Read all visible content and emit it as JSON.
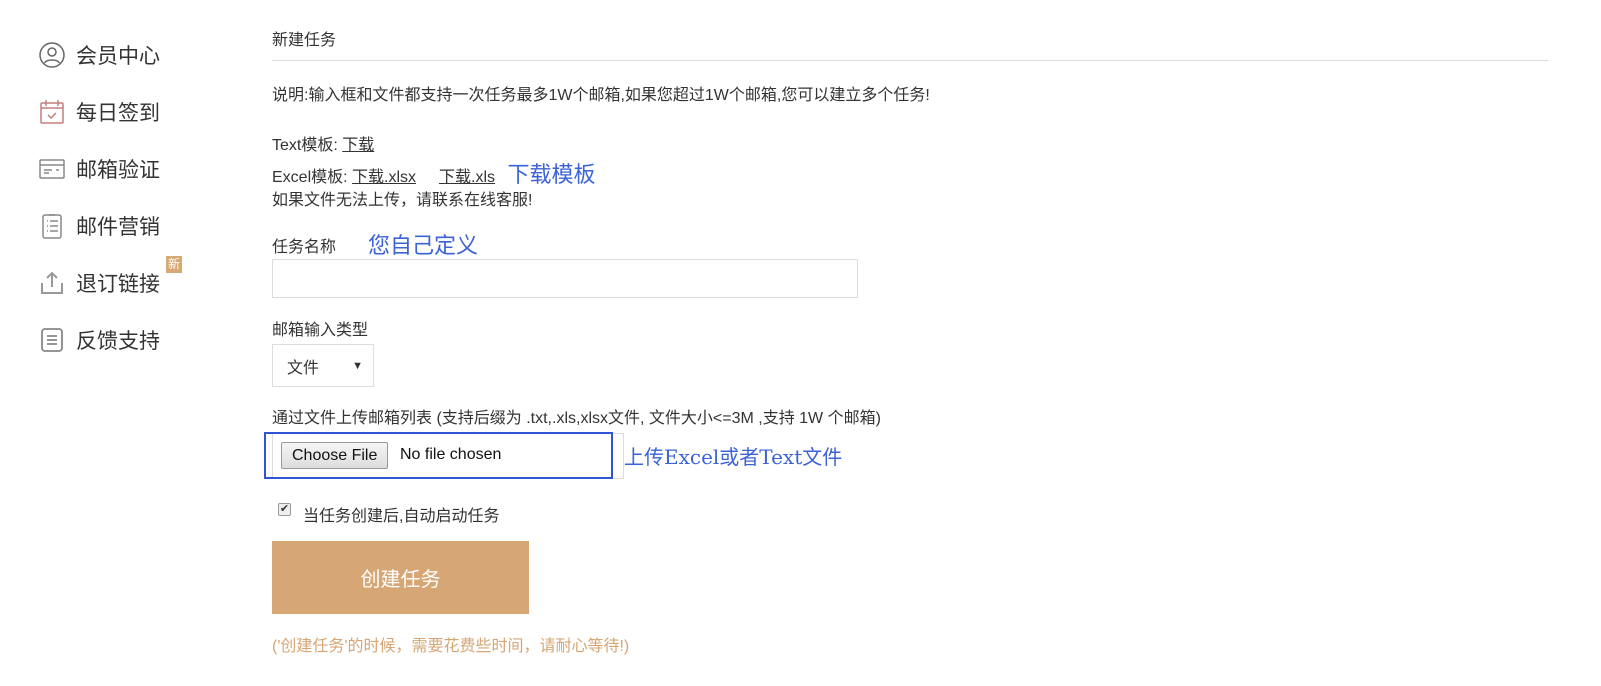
{
  "sidebar": {
    "items": [
      {
        "label": "会员中心",
        "icon": "user-circle-icon"
      },
      {
        "label": "每日签到",
        "icon": "calendar-check-icon"
      },
      {
        "label": "邮箱验证",
        "icon": "card-icon"
      },
      {
        "label": "邮件营销",
        "icon": "clipboard-list-icon"
      },
      {
        "label": "退订链接",
        "icon": "upload-icon",
        "badge": "新"
      },
      {
        "label": "反馈支持",
        "icon": "document-icon"
      }
    ]
  },
  "main": {
    "title": "新建任务",
    "description": "说明:输入框和文件都支持一次任务最多1W个邮箱,如果您超过1W个邮箱,您可以建立多个任务!",
    "text_template_label": "Text模板: ",
    "text_template_link": "下载",
    "excel_template_label": "Excel模板: ",
    "excel_xlsx_link": "下载.xlsx",
    "excel_xls_link": "下载.xls",
    "annotation_download": "下载模板",
    "upload_help": "如果文件无法上传，请联系在线客服!",
    "task_name_label": "任务名称",
    "annotation_task_name": "您自己定义",
    "task_name_value": "",
    "input_type_label": "邮箱输入类型",
    "input_type_selected": "文件",
    "file_label": "通过文件上传邮箱列表 (支持后缀为 .txt,.xls,xlsx文件, 文件大小<=3M ,支持 1W 个邮箱)",
    "choose_file": "Choose File",
    "no_file": "No file chosen",
    "annotation_upload": "上传Excel或者Text文件",
    "auto_start_label": "当任务创建后,自动启动任务",
    "auto_start_checked": true,
    "create_button": "创建任务",
    "create_note": "('创建任务'的时候，需要花费些时间，请耐心等待!)"
  },
  "colors": {
    "accent": "#d6a674",
    "annotation": "#3b63d6"
  }
}
